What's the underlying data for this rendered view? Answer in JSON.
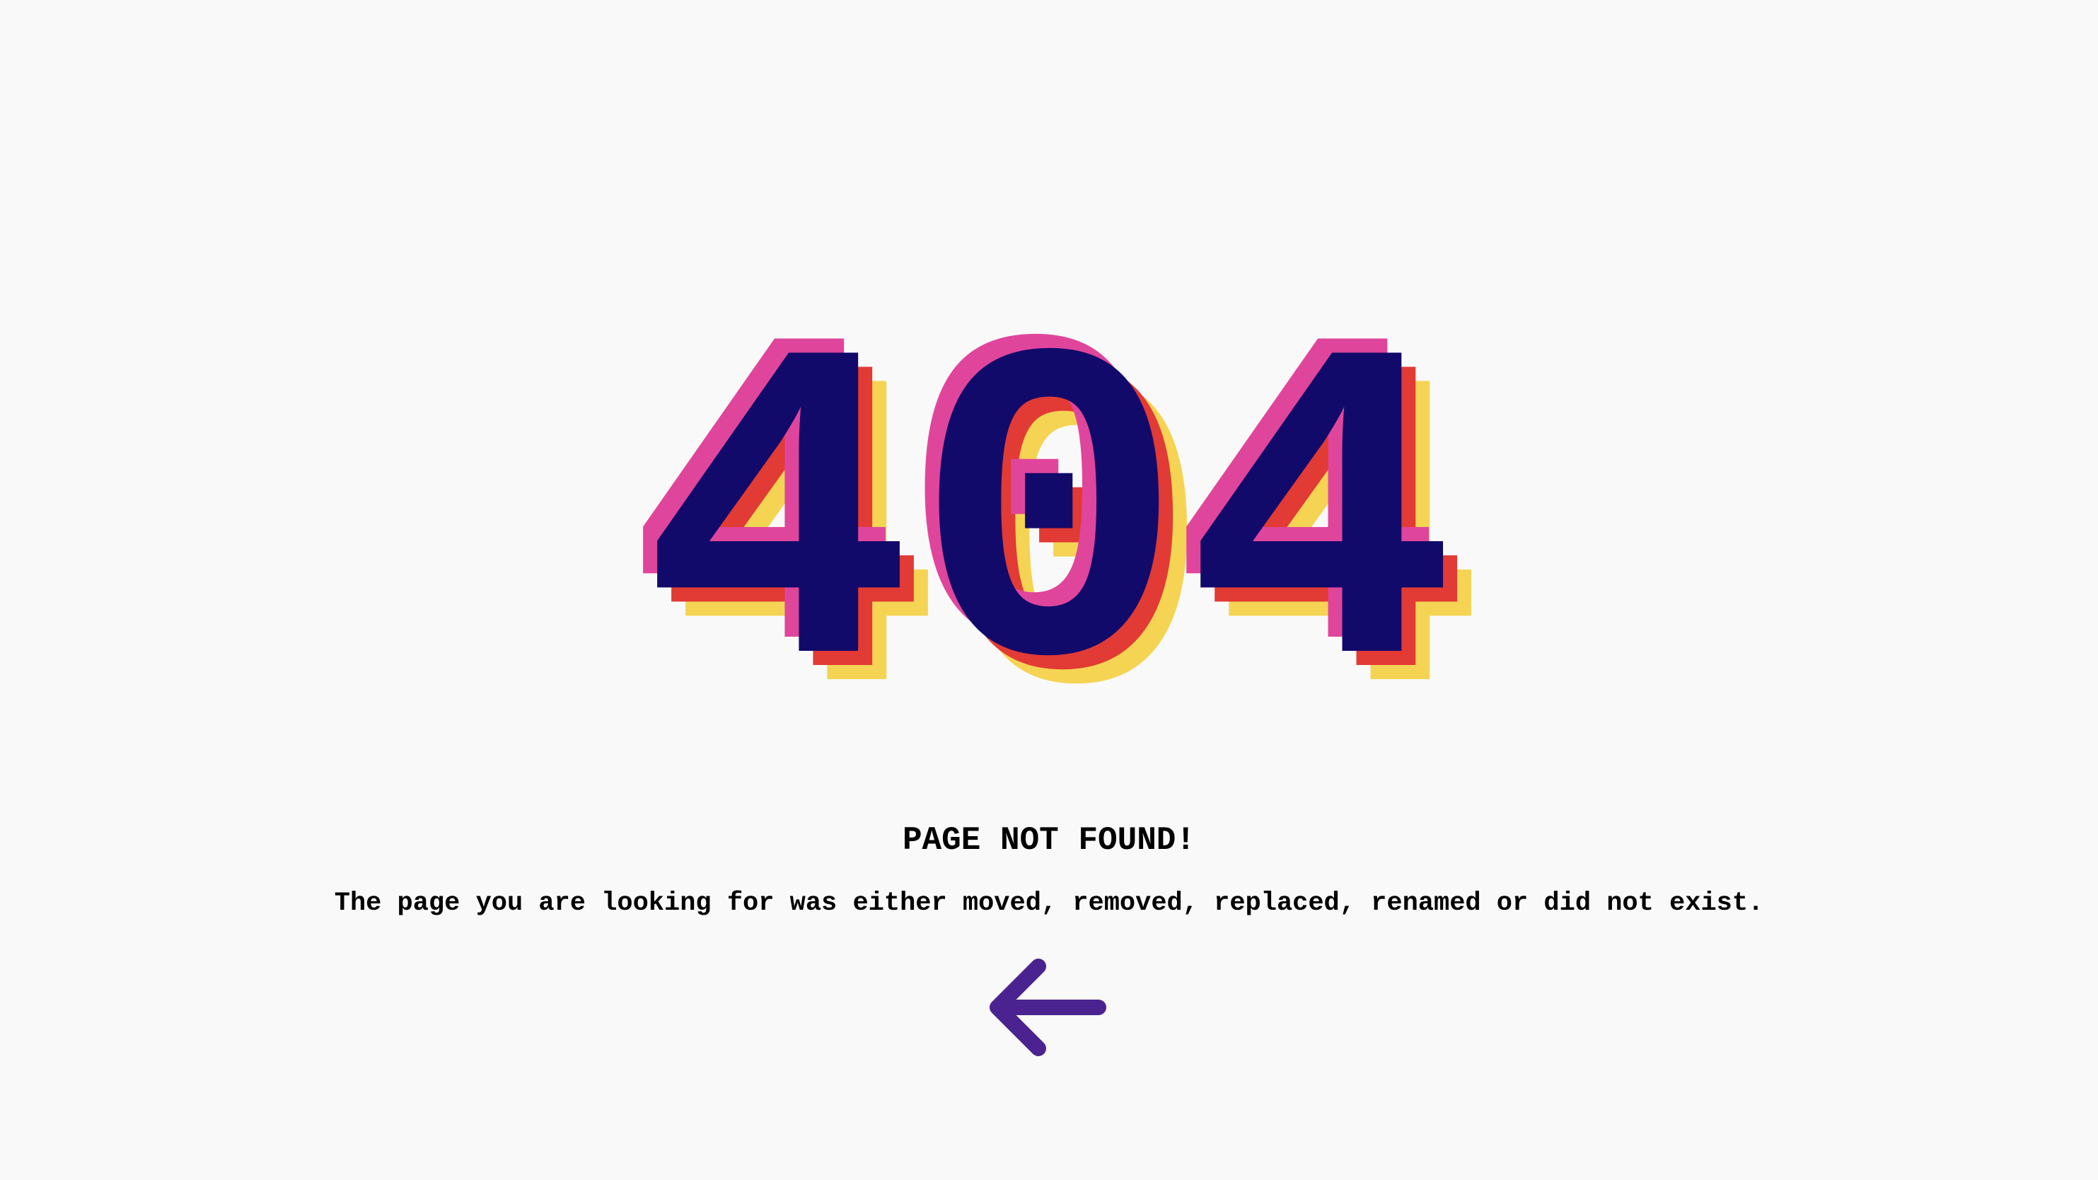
{
  "error_code": "404",
  "title": "PAGE NOT FOUND!",
  "message": "The page you are looking for was either moved, removed, replaced, renamed or did not exist.",
  "back_button": {
    "icon": "arrow-left-icon",
    "color": "#4b2390"
  },
  "colors": {
    "background": "#f9f9f9",
    "error_code_main": "#120a6a",
    "shadow_pink": "#e0459c",
    "shadow_red": "#e23a35",
    "shadow_yellow": "#f5d453",
    "text": "#000000"
  }
}
